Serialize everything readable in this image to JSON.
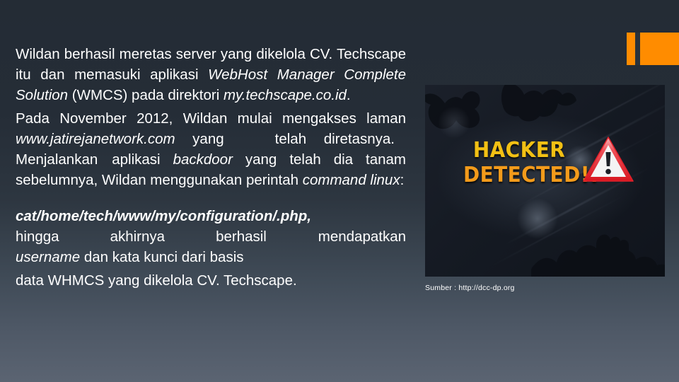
{
  "slide": {
    "background_top_color": "#242c35",
    "background_bottom_color": "#5b6472",
    "accent_color": "#ff8c00"
  },
  "body": {
    "paragraph_1": {
      "line_1": "Wildan berhasil meretas server yang dikelola CV.",
      "line_2_plain": "Techscape itu dan memasuki aplikasi ",
      "line_2_italic": "WebHost",
      "line_3_italic": "Manager Complete Solution",
      "line_3_plain": " (WMCS) pada",
      "line_4_plain": "direktori ",
      "line_4_italic": "my.techscape.co.id",
      "line_4_tail": "."
    },
    "paragraph_2": {
      "line_1": "Pada November 2012, Wildan mulai mengakses",
      "line_2_plain": "laman ",
      "line_2_italic": "www.jatirejanetwork.com",
      "line_2_tail": " yang",
      "line_2_tail2": "telah",
      "line_3_a": "diretasnya.",
      "line_3_b": "Menjalankan",
      "line_3_c": "aplikasi ",
      "line_3_italic": "backdoor",
      "line_3_tail": " yang",
      "line_4": "telah dia tanam sebelumnya, Wildan menggunakan",
      "line_5_plain": "perintah ",
      "line_5_italic": "command linux",
      "line_5_tail": ":"
    },
    "paragraph_3": {
      "line_1_bold_italic": "cat/home/tech/www/my/configuration/.php,",
      "line_2_a": "hingga",
      "line_2_b": "akhirnya",
      "line_2_c": "berhasil",
      "line_3_plain": "mendapatkan ",
      "line_3_italic": "username",
      "line_3_tail": " dan kata kunci dari basis",
      "line_4": "data WHMCS yang dikelola CV. Techscape."
    }
  },
  "picture": {
    "alt_name": "hacker-detected-banner",
    "headline_line_1": "HACKER",
    "headline_line_2": "DETECTED!!",
    "headline_line_1_color": "#f2c014",
    "headline_line_2_color": "#f39b1b",
    "warning_icon": "warning-triangle-icon",
    "warning_border_color": "#e2202a",
    "warning_fill_color": "#f2f2f2"
  },
  "caption": {
    "text": "Sumber : http://dcc-dp.org"
  }
}
